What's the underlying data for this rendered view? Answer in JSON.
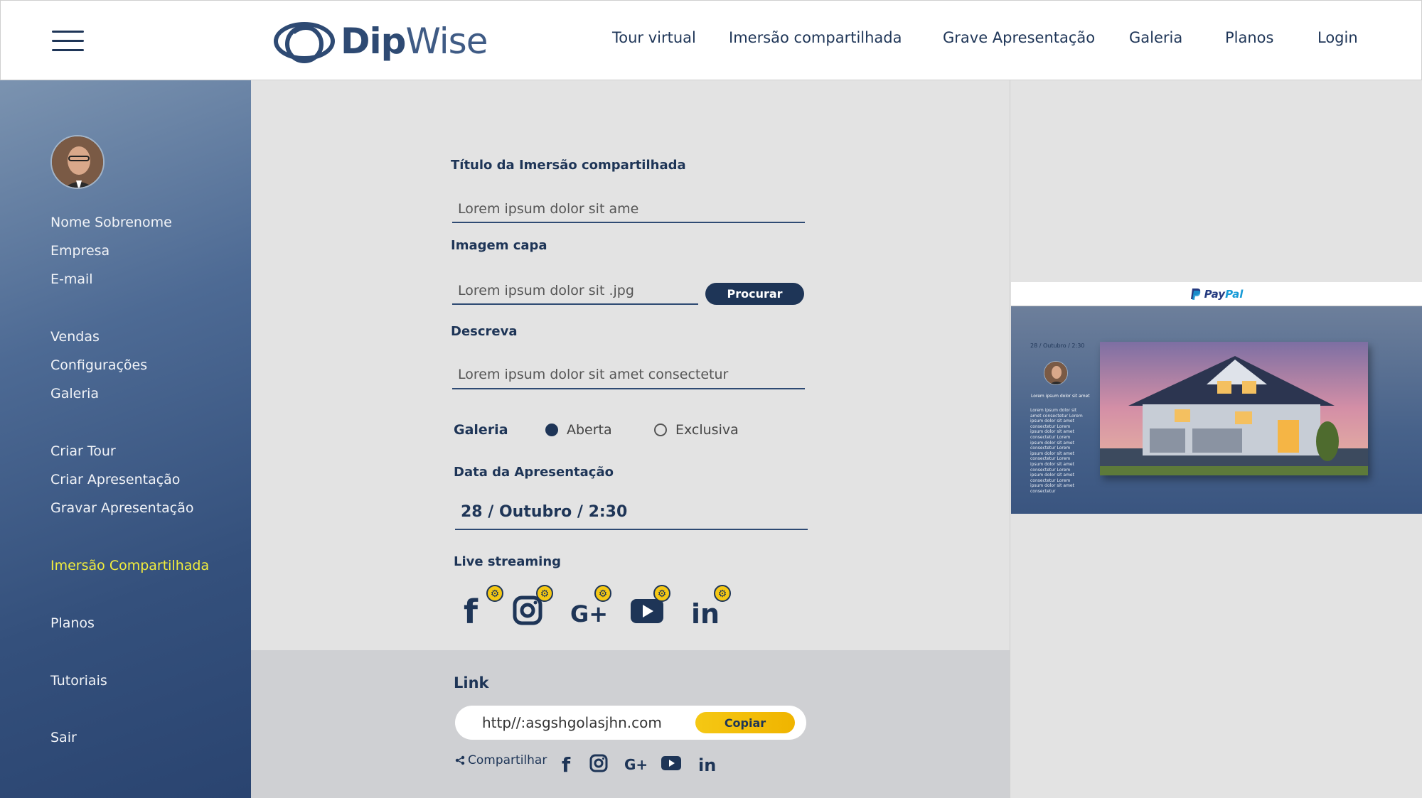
{
  "header": {
    "logo_text_1": "Dip",
    "logo_text_2": "Wise",
    "nav": [
      "Tour virtual",
      "Imersão compartilhada",
      "Grave Apresentação",
      "Galeria",
      "Planos",
      "Login"
    ]
  },
  "sidebar": {
    "profile": [
      "Nome Sobrenome",
      "Empresa",
      "E-mail"
    ],
    "group1": [
      "Vendas",
      "Configurações",
      "Galeria"
    ],
    "group2": [
      "Criar Tour",
      "Criar Apresentação",
      "Gravar Apresentação"
    ],
    "active": "Imersão Compartilhada",
    "planos": "Planos",
    "tutoriais": "Tutoriais",
    "sair": "Sair"
  },
  "form": {
    "titulo_label": "Título da Imersão compartilhada",
    "titulo_value": "Lorem ipsum dolor sit ame",
    "imagem_label": "Imagem capa",
    "imagem_value": "Lorem ipsum dolor sit .jpg",
    "procurar": "Procurar",
    "descreva_label": "Descreva",
    "descreva_value": "Lorem ipsum dolor sit amet consectetur",
    "galeria_label": "Galeria",
    "radio_aberta": "Aberta",
    "radio_exclusiva": "Exclusiva",
    "selected": "Aberta",
    "data_label": "Data da Apresentação",
    "data_value": "28 / Outubro / 2:30",
    "live_label": "Live streaming",
    "live_icons": [
      "facebook-icon",
      "instagram-icon",
      "google-plus-icon",
      "youtube-icon",
      "linkedin-icon"
    ]
  },
  "link": {
    "label": "Link",
    "url": "http//:asgshgolasjhn.com",
    "copiar": "Copiar",
    "compartilhar": "Compartilhar"
  },
  "preview": {
    "paypal_1": "Pay",
    "paypal_2": "Pal",
    "date": "28 / Outubro / 2:30",
    "name": "Lorem ipsum dolor sit amet",
    "lorem": "Lorem ipsum dolor sit amet consectetur Lorem ipsum dolor sit amet consectetur Lorem ipsum dolor sit amet consectetur Lorem ipsum dolor sit amet consectetur Lorem ipsum dolor sit amet consectetur Lorem ipsum dolor sit amet consectetur Lorem ipsum dolor sit amet consectetur Lorem ipsum dolor sit amet consectetur"
  },
  "colors": {
    "navy": "#1e3557",
    "accent_yellow": "#f3ee3c",
    "button_yellow": "#f5c814"
  }
}
